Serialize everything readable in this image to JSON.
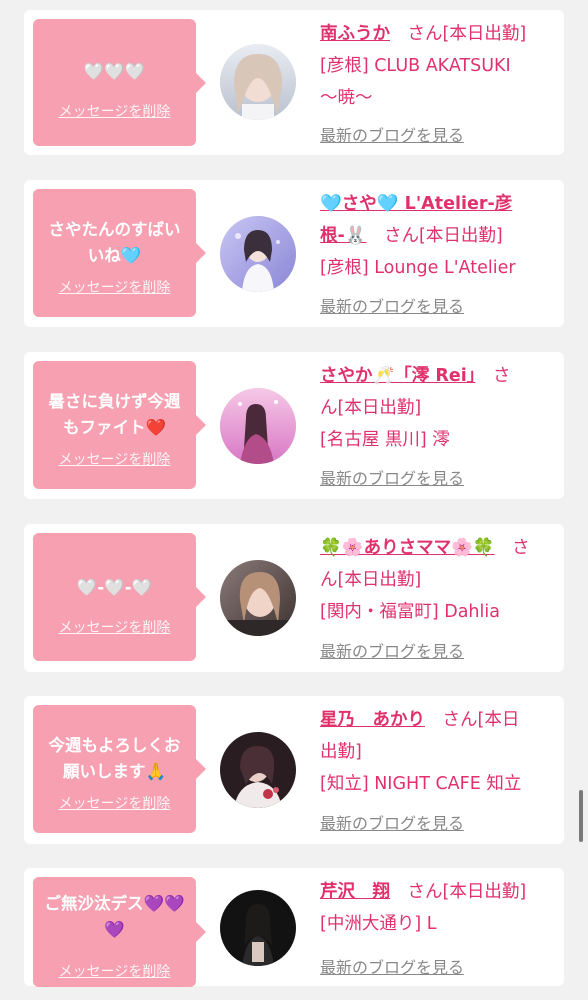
{
  "delete_label": "メッセージを削除",
  "blog_label": "最新のブログを見る",
  "colors": {
    "accent": "#e0316b",
    "bubble": "#f6a0b1",
    "link_gray": "#888888"
  },
  "cards": [
    {
      "message": "🤍🤍🤍",
      "name": "南ふうか",
      "san": "さん[本日出勤]",
      "shop_lines": [
        "[彦根] CLUB AKATSUKI",
        "〜暁〜"
      ]
    },
    {
      "message": "さやたんのすばい\nいね🩵",
      "name_lines": [
        "🩵さや🩵 L'Atelier-彦",
        "根-🐰"
      ],
      "san": "さん[本日出勤]",
      "shop_lines": [
        "[彦根] Lounge L'Atelier"
      ]
    },
    {
      "message": "暑さに負けず今週\nもファイト❤️",
      "name": "さやか🥂「澪 Rei」",
      "san_lines": [
        "さ",
        "ん[本日出勤]"
      ],
      "shop_lines": [
        "[名古屋 黒川] 澪"
      ]
    },
    {
      "message": "🤍-🤍-🤍",
      "name": "🍀🌸ありさママ🌸🍀",
      "san_lines": [
        "さ",
        "ん[本日出勤]"
      ],
      "shop_lines": [
        "[関内・福富町] Dahlia"
      ]
    },
    {
      "message": "今週もよろしくお\n願いします🙏",
      "name": "星乃　あかり",
      "san_lines": [
        "さん[本日",
        "出勤]"
      ],
      "shop_lines": [
        "[知立] NIGHT CAFE 知立"
      ]
    },
    {
      "message": "ご無沙汰デス💜💜\n💜",
      "name": "芹沢　翔",
      "san": "さん[本日出勤]",
      "shop_lines": [
        "[中洲大通り] L"
      ]
    }
  ]
}
